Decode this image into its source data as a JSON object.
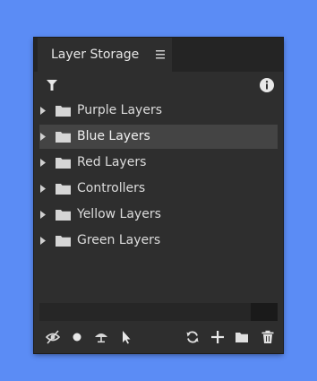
{
  "panel": {
    "title": "Layer Storage"
  },
  "folders": [
    {
      "label": "Purple Layers",
      "selected": false
    },
    {
      "label": "Blue Layers",
      "selected": true
    },
    {
      "label": "Red Layers",
      "selected": false
    },
    {
      "label": "Controllers",
      "selected": false
    },
    {
      "label": "Yellow Layers",
      "selected": false
    },
    {
      "label": "Green Layers",
      "selected": false
    }
  ],
  "icons": {
    "top": [
      "panel-menu-icon",
      "filter-icon",
      "info-icon"
    ],
    "bottom_left": [
      "visibility-off-icon",
      "record-dot-icon",
      "umbrella-icon",
      "cursor-icon"
    ],
    "bottom_right": [
      "refresh-icon",
      "add-icon",
      "folder-icon",
      "trash-icon"
    ]
  },
  "colors": {
    "background": "#5b8cf5",
    "panel": "#2e2e2e",
    "selected_row": "#444444",
    "text": "#dcdcdc"
  }
}
